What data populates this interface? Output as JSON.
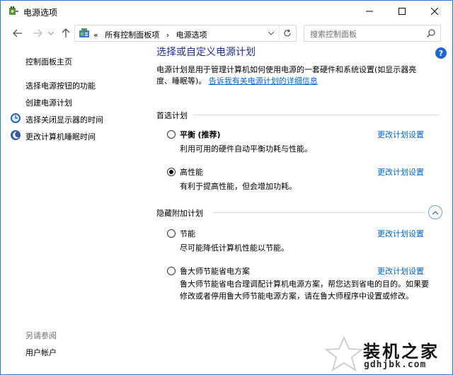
{
  "window": {
    "title": "电源选项",
    "controls": {
      "minimize": "minimize-icon",
      "maximize": "maximize-icon",
      "close": "close-icon"
    }
  },
  "address": {
    "crumbs": [
      "所有控制面板项",
      "电源选项"
    ],
    "overflow": "«"
  },
  "search": {
    "placeholder": "搜索控制面板"
  },
  "sidebar": {
    "home": "控制面板主页",
    "links": [
      {
        "label": "选择电源按钮的功能",
        "icon": ""
      },
      {
        "label": "创建电源计划",
        "icon": ""
      },
      {
        "label": "选择关闭显示器的时间",
        "icon": "monitor-clock-icon"
      },
      {
        "label": "更改计算机睡眠时间",
        "icon": "moon-icon"
      }
    ],
    "see_also": "另请参阅",
    "see_also_links": [
      "用户帐户"
    ]
  },
  "main": {
    "title": "选择或自定义电源计划",
    "intro": "电源计划是用于管理计算机如何使用电源的一套硬件和系统设置(如显示器亮度、睡眠等)。",
    "intro_link": "告诉我有关电源计划的详细信息",
    "preferred_header": "首选计划",
    "hidden_header": "隐藏附加计划",
    "change_link": "更改计划设置",
    "plans": [
      {
        "name": "平衡",
        "tag": "(推荐)",
        "desc": "利用可用的硬件自动平衡功耗与性能。",
        "checked": false
      },
      {
        "name": "高性能",
        "tag": "",
        "desc": "有利于提高性能，但会增加功耗。",
        "checked": true
      },
      {
        "name": "节能",
        "tag": "",
        "desc": "尽可能降低计算机性能以节能。",
        "checked": false
      },
      {
        "name": "鲁大师节能省电方案",
        "tag": "",
        "desc": "鲁大师节能省电合理调配计算机电源方案，帮您达到省电的目的。如果要修改或者停用鲁大师节能电源方案，请在鲁大师程序中设置或修改。",
        "checked": false
      }
    ]
  },
  "watermark": {
    "text": "装机之家",
    "url": "gdhjbk.com"
  },
  "colors": {
    "link": "#0066cc",
    "title": "#1e3287",
    "accent": "#1e66d5"
  }
}
